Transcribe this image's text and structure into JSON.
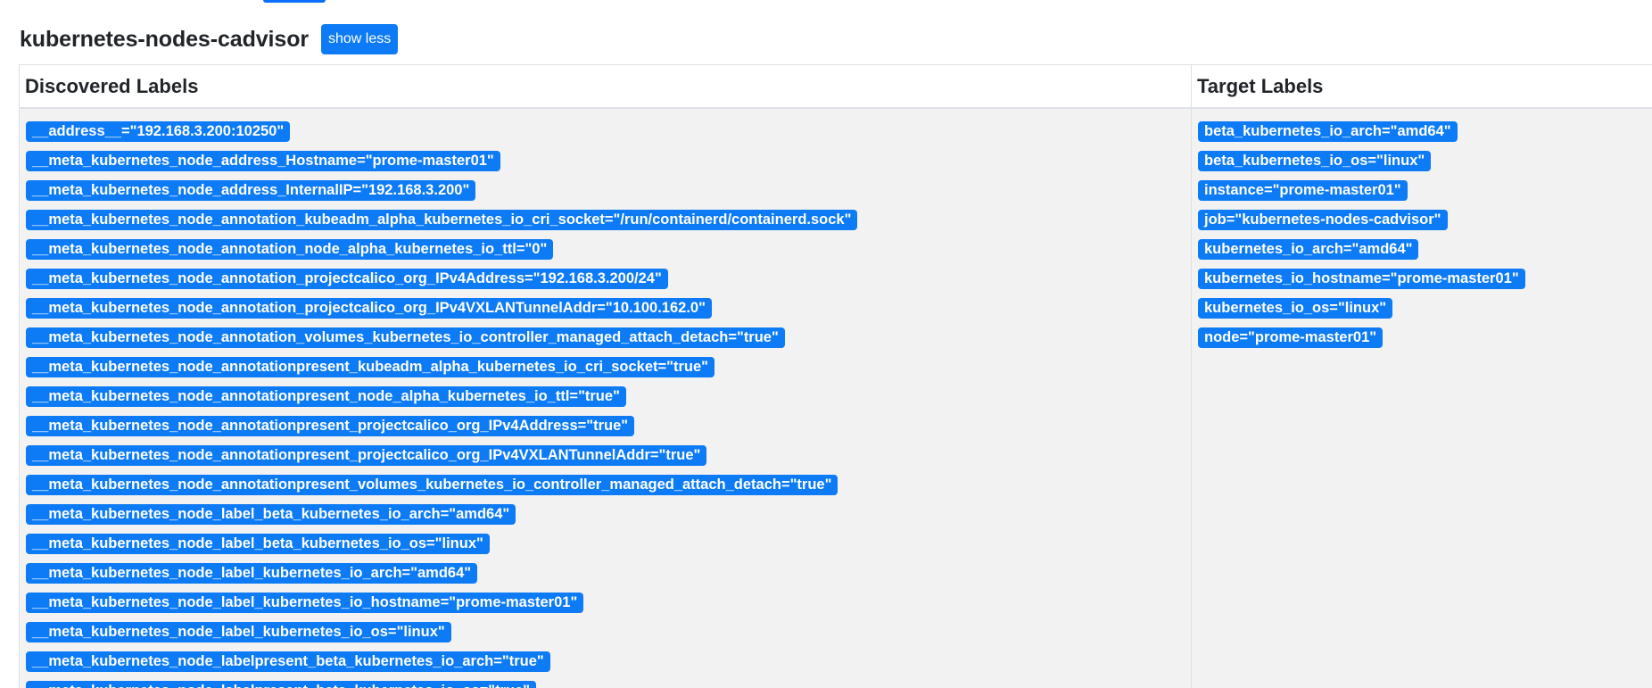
{
  "job": {
    "title": "kubernetes-nodes-cadvisor",
    "toggle_label": "show less"
  },
  "table": {
    "headers": {
      "discovered": "Discovered Labels",
      "target": "Target Labels"
    },
    "discovered_labels": [
      "__address__=\"192.168.3.200:10250\"",
      "__meta_kubernetes_node_address_Hostname=\"prome-master01\"",
      "__meta_kubernetes_node_address_InternalIP=\"192.168.3.200\"",
      "__meta_kubernetes_node_annotation_kubeadm_alpha_kubernetes_io_cri_socket=\"/run/containerd/containerd.sock\"",
      "__meta_kubernetes_node_annotation_node_alpha_kubernetes_io_ttl=\"0\"",
      "__meta_kubernetes_node_annotation_projectcalico_org_IPv4Address=\"192.168.3.200/24\"",
      "__meta_kubernetes_node_annotation_projectcalico_org_IPv4VXLANTunnelAddr=\"10.100.162.0\"",
      "__meta_kubernetes_node_annotation_volumes_kubernetes_io_controller_managed_attach_detach=\"true\"",
      "__meta_kubernetes_node_annotationpresent_kubeadm_alpha_kubernetes_io_cri_socket=\"true\"",
      "__meta_kubernetes_node_annotationpresent_node_alpha_kubernetes_io_ttl=\"true\"",
      "__meta_kubernetes_node_annotationpresent_projectcalico_org_IPv4Address=\"true\"",
      "__meta_kubernetes_node_annotationpresent_projectcalico_org_IPv4VXLANTunnelAddr=\"true\"",
      "__meta_kubernetes_node_annotationpresent_volumes_kubernetes_io_controller_managed_attach_detach=\"true\"",
      "__meta_kubernetes_node_label_beta_kubernetes_io_arch=\"amd64\"",
      "__meta_kubernetes_node_label_beta_kubernetes_io_os=\"linux\"",
      "__meta_kubernetes_node_label_kubernetes_io_arch=\"amd64\"",
      "__meta_kubernetes_node_label_kubernetes_io_hostname=\"prome-master01\"",
      "__meta_kubernetes_node_label_kubernetes_io_os=\"linux\"",
      "__meta_kubernetes_node_labelpresent_beta_kubernetes_io_arch=\"true\"",
      "__meta_kubernetes_node_labelpresent_beta_kubernetes_io_os=\"true\""
    ],
    "target_labels": [
      "beta_kubernetes_io_arch=\"amd64\"",
      "beta_kubernetes_io_os=\"linux\"",
      "instance=\"prome-master01\"",
      "job=\"kubernetes-nodes-cadvisor\"",
      "kubernetes_io_arch=\"amd64\"",
      "kubernetes_io_hostname=\"prome-master01\"",
      "kubernetes_io_os=\"linux\"",
      "node=\"prome-master01\""
    ]
  },
  "colors": {
    "badge_bg": "#0d7bf5",
    "badge_text": "#ffffff",
    "table_body_bg": "#f2f2f2",
    "border": "#dee2e6"
  }
}
